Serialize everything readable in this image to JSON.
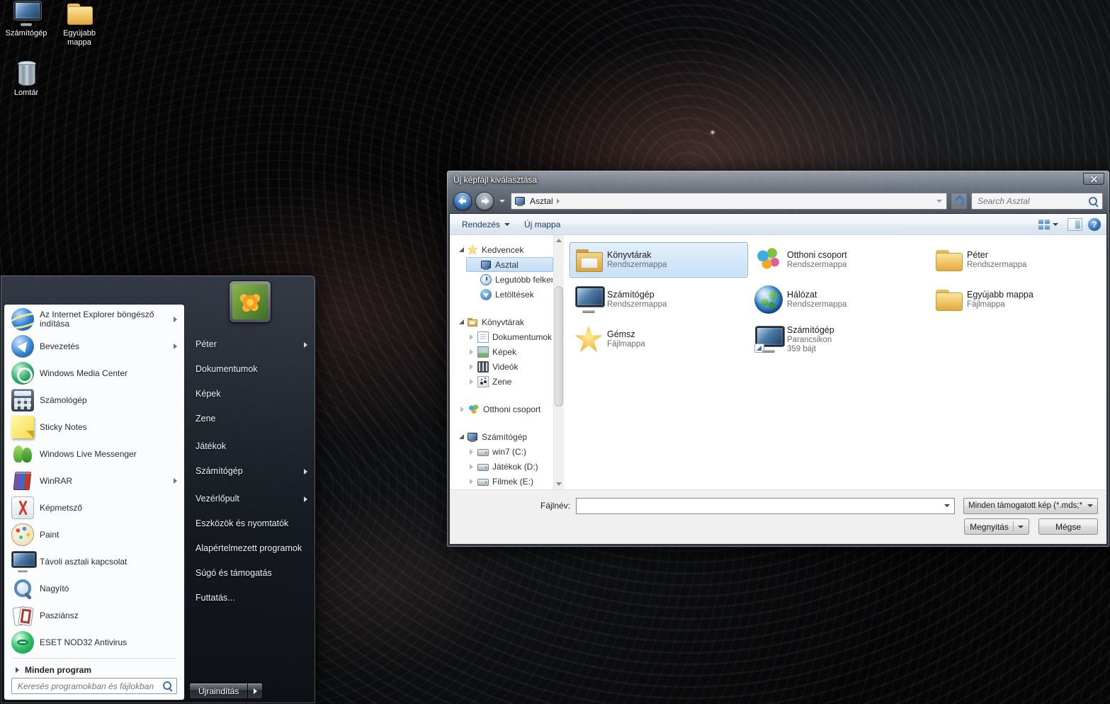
{
  "theme": {
    "selection_fill": "#c8e0f7",
    "selection_border": "#84a9d1",
    "glass_dark": "#3a404a",
    "titlebar_text": "#ffffff"
  },
  "glyphs": {
    "help": "?"
  },
  "desktop": {
    "icons": [
      {
        "label": "Számítógép",
        "icon": "computer"
      },
      {
        "label": "Egyújabb mappa",
        "icon": "folder"
      },
      {
        "label": "Lomtár",
        "icon": "recycle-bin"
      }
    ]
  },
  "start_menu": {
    "left_items": [
      {
        "label": "Az Internet Explorer böngésző indítása",
        "icon": "internet-explorer",
        "has_submenu": true
      },
      {
        "label": "Bevezetés",
        "icon": "getting-started",
        "has_submenu": true
      },
      {
        "label": "Windows Media Center",
        "icon": "media-center",
        "has_submenu": false
      },
      {
        "label": "Számológép",
        "icon": "calculator",
        "has_submenu": false
      },
      {
        "label": "Sticky Notes",
        "icon": "sticky-notes",
        "has_submenu": false
      },
      {
        "label": "Windows Live Messenger",
        "icon": "messenger",
        "has_submenu": false
      },
      {
        "label": "WinRAR",
        "icon": "winrar",
        "has_submenu": true
      },
      {
        "label": "Képmetsző",
        "icon": "snipping-tool",
        "has_submenu": false
      },
      {
        "label": "Paint",
        "icon": "paint",
        "has_submenu": false
      },
      {
        "label": "Távoli asztali kapcsolat",
        "icon": "remote-desktop",
        "has_submenu": false
      },
      {
        "label": "Nagyító",
        "icon": "magnifier",
        "has_submenu": false
      },
      {
        "label": "Pasziánsz",
        "icon": "solitaire",
        "has_submenu": false
      },
      {
        "label": "ESET NOD32 Antivirus",
        "icon": "eset",
        "has_submenu": false
      }
    ],
    "all_programs_label": "Minden program",
    "search_placeholder": "Keresés programokban és fájlokban",
    "user_name": "Péter",
    "right_items": [
      {
        "label": "Péter",
        "has_submenu": true
      },
      {
        "label": "Dokumentumok",
        "has_submenu": false
      },
      {
        "label": "Képek",
        "has_submenu": false
      },
      {
        "label": "Zene",
        "has_submenu": false
      },
      {
        "label": "Játékok",
        "has_submenu": false
      },
      {
        "label": "Számítógép",
        "has_submenu": true
      },
      {
        "label": "Vezérlőpult",
        "has_submenu": true
      },
      {
        "label": "Eszközök és nyomtatók",
        "has_submenu": false
      },
      {
        "label": "Alapértelmezett programok",
        "has_submenu": false
      },
      {
        "label": "Súgó és támogatás",
        "has_submenu": false
      },
      {
        "label": "Futtatás...",
        "has_submenu": false
      }
    ],
    "restart_label": "Újraindítás"
  },
  "dialog": {
    "title": "Új képfájl kiválasztása",
    "breadcrumb": "Asztal",
    "search_placeholder": "Search Asztal",
    "toolbar": {
      "organize": "Rendezés",
      "new_folder": "Új mappa"
    },
    "sidebar_items": [
      {
        "label": "Kedvencek",
        "icon": "favorites-star"
      },
      {
        "label": "Asztal",
        "icon": "desktop",
        "selected": true
      },
      {
        "label": "Legutóbb felkere",
        "icon": "recent-places"
      },
      {
        "label": "Letöltések",
        "icon": "downloads"
      },
      {
        "label": "Könyvtárak",
        "icon": "libraries"
      },
      {
        "label": "Dokumentumok",
        "icon": "documents-library"
      },
      {
        "label": "Képek",
        "icon": "pictures-library"
      },
      {
        "label": "Videók",
        "icon": "videos-library"
      },
      {
        "label": "Zene",
        "icon": "music-library"
      },
      {
        "label": "Otthoni csoport",
        "icon": "homegroup"
      },
      {
        "label": "Számítógép",
        "icon": "computer"
      },
      {
        "label": "win7 (C:)",
        "icon": "drive"
      },
      {
        "label": "Játékok (D:)",
        "icon": "drive"
      },
      {
        "label": "Filmek (E:)",
        "icon": "drive"
      }
    ],
    "files": [
      {
        "name": "Könyvtárak",
        "type": "Rendszermappa",
        "icon": "libraries",
        "selected": true
      },
      {
        "name": "Otthoni csoport",
        "type": "Rendszermappa",
        "icon": "homegroup"
      },
      {
        "name": "Péter",
        "type": "Rendszermappa",
        "icon": "user-folder"
      },
      {
        "name": "Számítógép",
        "type": "Rendszermappa",
        "icon": "computer"
      },
      {
        "name": "Hálózat",
        "type": "Rendszermappa",
        "icon": "network-globe"
      },
      {
        "name": "Egyújabb mappa",
        "type": "Fájlmappa",
        "icon": "folder"
      },
      {
        "name": "Gémsz",
        "type": "Fájlmappa",
        "icon": "star"
      },
      {
        "name": "Számítógép",
        "type": "Parancsikon",
        "size": "359 bájt",
        "icon": "computer-shortcut"
      }
    ],
    "footer": {
      "filename_label": "Fájlnév:",
      "filename_value": "",
      "filetype_value": "Minden támogatott kép (*.mds;*",
      "open_label": "Megnyitás",
      "cancel_label": "Mégse"
    }
  }
}
